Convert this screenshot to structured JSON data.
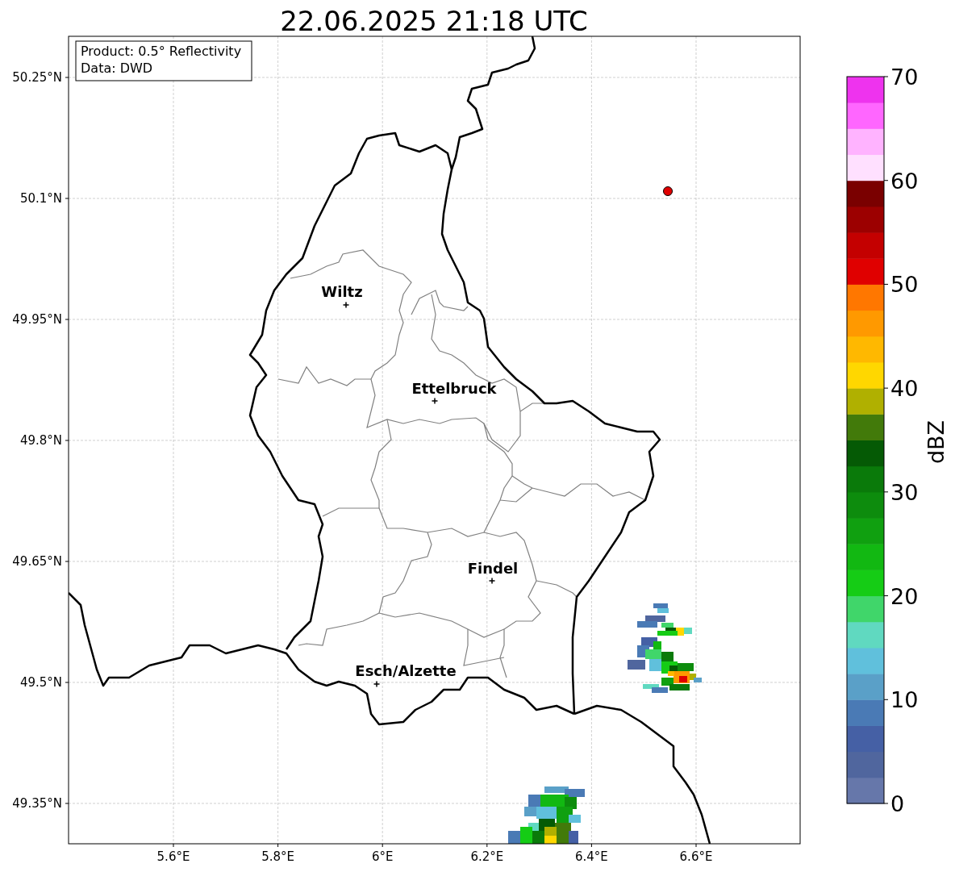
{
  "title": "22.06.2025 21:18 UTC",
  "info_box": [
    "Product: 0.5° Reflectivity",
    "Data: DWD"
  ],
  "cities": [
    {
      "name": "Wiltz"
    },
    {
      "name": "Ettelbruck"
    },
    {
      "name": "Findel"
    },
    {
      "name": "Esch/Alzette"
    }
  ],
  "lat_ticks": [
    "50.25°N",
    "50.1°N",
    "49.95°N",
    "49.8°N",
    "49.65°N",
    "49.5°N",
    "49.35°N"
  ],
  "lon_ticks": [
    "5.6°E",
    "5.8°E",
    "6°E",
    "6.2°E",
    "6.4°E",
    "6.6°E"
  ],
  "colorbar": {
    "label": "dBZ",
    "ticks": [
      "70",
      "60",
      "50",
      "40",
      "30",
      "20",
      "10",
      "0"
    ]
  }
}
